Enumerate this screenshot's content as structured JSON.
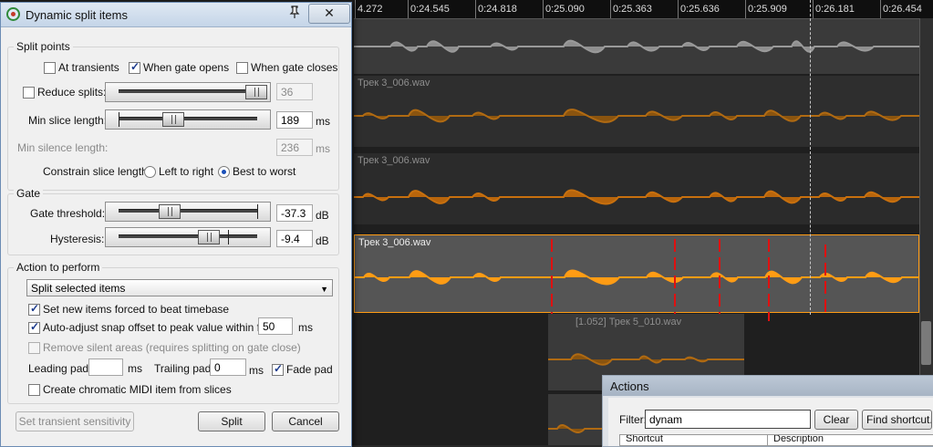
{
  "timeline": {
    "ruler_ticks": [
      "4.272",
      "0:24.545",
      "0:24.818",
      "0:25.090",
      "0:25.363",
      "0:25.636",
      "0:25.909",
      "0:26.181",
      "0:26.454"
    ],
    "tracks": [
      {
        "label": "",
        "color": "#8f8f8f"
      },
      {
        "label": "Трек 3_006.wav",
        "color": "#b06a12"
      },
      {
        "label": "Трек 3_006.wav",
        "color": "#c8700e"
      },
      {
        "label": "Трек 3_006.wav",
        "color": "#ff9c14"
      }
    ],
    "item_label": "[1.052] Трек 5_010.wav",
    "colors": {
      "selected_item": "#ff9c14",
      "split_marker": "#e01010",
      "background": "#1f1f1f"
    }
  },
  "dialog": {
    "title": "Dynamic split items",
    "pin_icon": "pin-icon",
    "close_label": "✕",
    "split_points": {
      "group_title": "Split points",
      "at_transients": {
        "label": "At transients",
        "checked": false
      },
      "when_gate_opens": {
        "label": "When gate opens",
        "checked": true
      },
      "when_gate_closes": {
        "label": "When gate closes",
        "checked": false
      },
      "reduce_splits": {
        "label": "Reduce splits:",
        "checked": false,
        "value": "36",
        "level": 0.97
      },
      "min_slice_length": {
        "label": "Min slice length:",
        "value": "189",
        "unit": "ms",
        "level": 0.35
      },
      "min_silence_length": {
        "label": "Min silence length:",
        "value": "236",
        "unit": "ms"
      },
      "constrain_slice_length": {
        "label": "Constrain slice length:",
        "options": [
          "Left to right",
          "Best to worst"
        ],
        "selected": "Best to worst"
      }
    },
    "gate": {
      "group_title": "Gate",
      "gate_threshold": {
        "label": "Gate threshold:",
        "value": "-37.3",
        "unit": "dB",
        "level": 0.32
      },
      "hysteresis": {
        "label": "Hysteresis:",
        "value": "-9.4",
        "unit": "dB",
        "level": 0.65
      }
    },
    "action": {
      "group_title": "Action to perform",
      "selected": "Split selected items",
      "force_beat_timebase": {
        "label": "Set new items forced to beat timebase",
        "checked": true
      },
      "auto_adjust_snap": {
        "label": "Auto-adjust snap offset to peak value within first:",
        "checked": true,
        "value": "50",
        "unit": "ms"
      },
      "remove_silent": {
        "label": "Remove silent areas (requires splitting on gate close)",
        "checked": false
      },
      "leading_pad": {
        "label": "Leading pad:",
        "value": "",
        "unit": "ms"
      },
      "trailing_pad": {
        "label": "Trailing pad:",
        "value": "0",
        "unit": "ms"
      },
      "fade_pad": {
        "label": "Fade pad",
        "checked": true
      },
      "create_midi": {
        "label": "Create chromatic MIDI item from slices",
        "checked": false
      }
    },
    "buttons": {
      "transient_sensitivity": "Set transient sensitivity",
      "split": "Split",
      "cancel": "Cancel"
    }
  },
  "actions_window": {
    "title": "Actions",
    "filter_label": "Filter:",
    "filter_value": "dynam",
    "clear_label": "Clear",
    "find_shortcut_label": "Find shortcut...",
    "columns": [
      "Shortcut",
      "Description"
    ]
  }
}
